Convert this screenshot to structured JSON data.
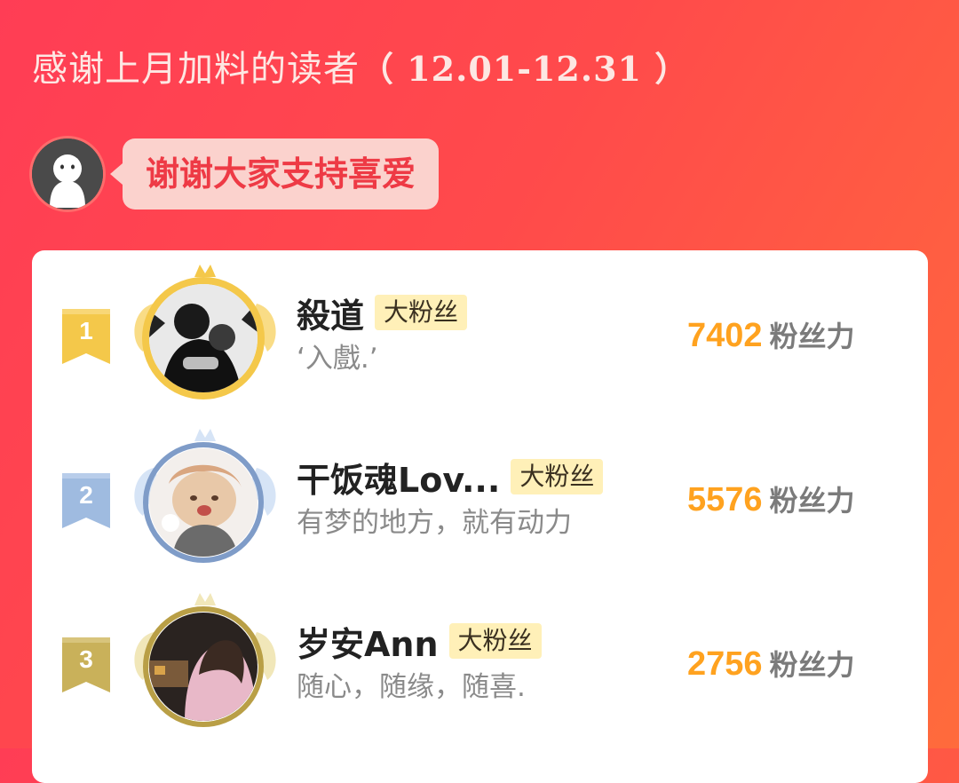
{
  "header": {
    "title_text": "感谢上月加料的读者",
    "date_range": "（ 12.01-12.31 ）"
  },
  "speaker": {
    "avatar_icon": "ghost-avatar-icon",
    "message": "谢谢大家支持喜爱"
  },
  "colors": {
    "gold": "#f4c84a",
    "silver": "#9fbbe0",
    "bronze": "#c9b15a",
    "score": "#ffa21f",
    "badge_bg": "#fff0b8"
  },
  "ranking": [
    {
      "rank": "1",
      "name": "殺道",
      "badge": "大粉丝",
      "motto": "‘入戲.’",
      "score": "7402",
      "unit": "粉丝力"
    },
    {
      "rank": "2",
      "name": "干饭魂Lov...",
      "badge": "大粉丝",
      "motto": "有梦的地方，就有动力",
      "score": "5576",
      "unit": "粉丝力"
    },
    {
      "rank": "3",
      "name": "岁安Ann",
      "badge": "大粉丝",
      "motto": "随心，随缘，随喜.",
      "score": "2756",
      "unit": "粉丝力"
    }
  ]
}
